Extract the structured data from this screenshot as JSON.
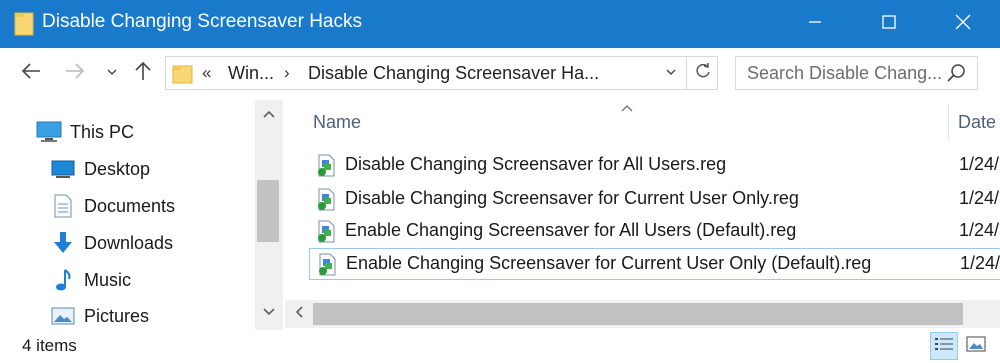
{
  "window": {
    "title": "Disable Changing Screensaver Hacks",
    "accent": "#1979ca"
  },
  "titlebar_icons": {
    "folder": "folder-icon",
    "minimize": "minimize-icon",
    "maximize": "maximize-icon",
    "close": "close-icon"
  },
  "navbar": {
    "address": {
      "overflow_chevron": "«",
      "crumbs": [
        "Win...",
        "Disable Changing Screensaver Ha..."
      ],
      "separator": "›"
    },
    "search": {
      "placeholder": "Search Disable Chang..."
    }
  },
  "navigation_pane": {
    "items": [
      {
        "label": "This PC",
        "icon": "computer-icon"
      },
      {
        "label": "Desktop",
        "icon": "desktop-icon"
      },
      {
        "label": "Documents",
        "icon": "documents-icon"
      },
      {
        "label": "Downloads",
        "icon": "downloads-icon"
      },
      {
        "label": "Music",
        "icon": "music-icon"
      },
      {
        "label": "Pictures",
        "icon": "pictures-icon"
      }
    ]
  },
  "file_list": {
    "columns": {
      "name": "Name",
      "date": "Date"
    },
    "files": [
      {
        "name": "Disable Changing Screensaver for All Users.reg",
        "date": "1/24/"
      },
      {
        "name": "Disable Changing Screensaver for Current User Only.reg",
        "date": "1/24/"
      },
      {
        "name": "Enable Changing Screensaver for All Users (Default).reg",
        "date": "1/24/"
      },
      {
        "name": "Enable Changing Screensaver for Current User Only (Default).reg",
        "date": "1/24/"
      }
    ]
  },
  "status": {
    "item_count": "4 items",
    "views": [
      "details-view-icon",
      "large-icons-view-icon"
    ]
  }
}
